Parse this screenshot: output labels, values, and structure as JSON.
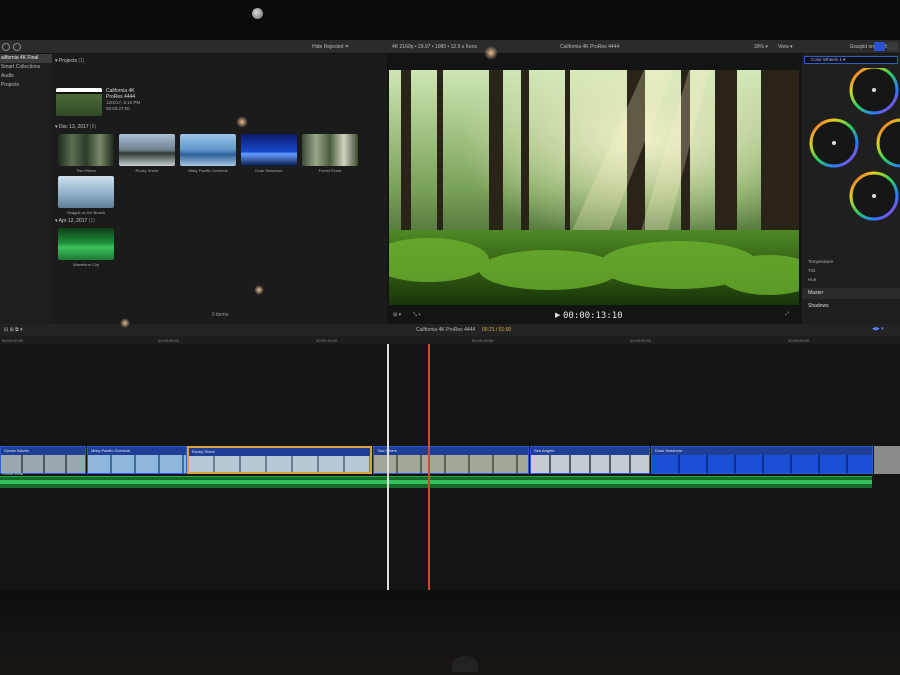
{
  "toolbar": {
    "hide_rejected": "Hide Rejected ≑",
    "format": "4K 2160p • 29.97 • 1080 • 12.5 s Kens",
    "project_title": "California 4K ProRes 4444",
    "zoom": "39% ▾",
    "view": "View ▾",
    "inspector_title": "Graspid on the Beach"
  },
  "sidebar": {
    "items": [
      {
        "label": "alifornia 4K Final",
        "selected": true
      },
      {
        "label": "Smart Collections",
        "selected": false
      },
      {
        "label": "Audio",
        "selected": false
      },
      {
        "label": "Projects",
        "selected": false
      }
    ]
  },
  "browser": {
    "projects_header": "Projects",
    "projects_count": "(1)",
    "project": {
      "name": "California 4K",
      "format": "ProRes 4444",
      "date": "12/4/17, 6:16 PM",
      "duration": "00:03:27:00"
    },
    "event1_header": "Dec 13, 2017",
    "event1_count": "(6)",
    "event1_clips": [
      "Two Hikers",
      "Rocky Shore",
      "Misty Pacific Overlook",
      "Dusk Seashore",
      "Forest Ferns"
    ],
    "event1_row2": [
      "Seagull on the Beach"
    ],
    "event2_header": "Apr 12, 2017",
    "event2_count": "(1)",
    "event2_clips": [
      "Waveform Clip"
    ],
    "footer": "6 items"
  },
  "viewer": {
    "timecode": "00:00:13:10",
    "playing": "▶"
  },
  "inspector": {
    "dropdown": "Color Wheels 1 ▾",
    "wheel_labels": [
      "MASTER",
      "SHADOWS",
      "MIDTONES",
      "HIGHLIGHTS"
    ],
    "rows": [
      "Temperature",
      "Tint",
      "Hue"
    ],
    "tabs": [
      "Master",
      "Shadows"
    ]
  },
  "timeline": {
    "index_label": "Index",
    "project_name": "California 4K ProRes 4444",
    "position": "00:21 / 01:00",
    "ruler_ticks": [
      "00:00:00:00",
      "00:00:05:00",
      "00:00:10:00",
      "00:00:15:00",
      "00:00:20:00",
      "00:00:25:00"
    ],
    "clips": [
      {
        "name": "Ocean Waves"
      },
      {
        "name": "Misty Pacific Overlook"
      },
      {
        "name": "Rocky Shore"
      },
      {
        "name": "Two Hikers"
      },
      {
        "name": "Sea Angels"
      },
      {
        "name": "Dusk Seashore"
      }
    ],
    "audio_label": "Ocean Beat"
  },
  "colors": {
    "clip_blue": "#1f3e96",
    "selection_gold": "#d8a53b",
    "playhead_red": "#d9442b",
    "audio_green": "#34c05a"
  }
}
